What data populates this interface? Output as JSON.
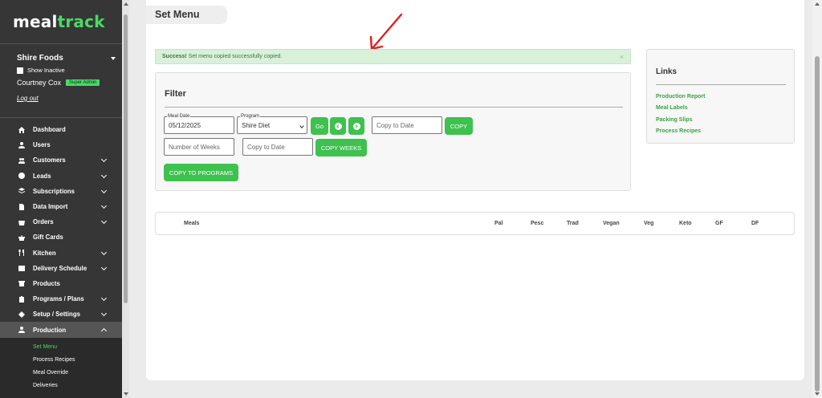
{
  "logo": {
    "part1": "meal",
    "part2": "track"
  },
  "account": {
    "name": "Shire Foods",
    "show_inactive": "Show Inactive",
    "user": "Courtney Cox",
    "role": "Super Admin",
    "logout": "Log out"
  },
  "nav": [
    {
      "label": "Dashboard",
      "icon": "home-icon",
      "has_sub": false
    },
    {
      "label": "Users",
      "icon": "user-icon",
      "has_sub": false
    },
    {
      "label": "Customers",
      "icon": "users-icon",
      "has_sub": true
    },
    {
      "label": "Leads",
      "icon": "bolt-icon",
      "has_sub": true
    },
    {
      "label": "Subscriptions",
      "icon": "layers-icon",
      "has_sub": true
    },
    {
      "label": "Data Import",
      "icon": "file-icon",
      "has_sub": true
    },
    {
      "label": "Orders",
      "icon": "basket-icon",
      "has_sub": true
    },
    {
      "label": "Gift Cards",
      "icon": "gift-icon",
      "has_sub": false
    },
    {
      "label": "Kitchen",
      "icon": "utensils-icon",
      "has_sub": true
    },
    {
      "label": "Delivery Schedule",
      "icon": "calendar-icon",
      "has_sub": true
    },
    {
      "label": "Products",
      "icon": "box-icon",
      "has_sub": false
    },
    {
      "label": "Programs / Plans",
      "icon": "clipboard-icon",
      "has_sub": true
    },
    {
      "label": "Setup / Settings",
      "icon": "gear-icon",
      "has_sub": true
    },
    {
      "label": "Production",
      "icon": "user-icon",
      "has_sub": true,
      "expanded": true
    }
  ],
  "subnav": [
    "Set Menu",
    "Process Recipes",
    "Meal Override",
    "Deliveries"
  ],
  "page": {
    "title": "Set Menu"
  },
  "alert": {
    "strong": "Success!",
    "message": " Set menu copied successfully copied.",
    "close": "×"
  },
  "filter": {
    "title": "Filter",
    "meal_date_label": "Meal Date",
    "meal_date_value": "05/12/2025",
    "program_label": "Program",
    "program_value": "Shire Diet",
    "go": "Go",
    "copy_to_date_placeholder": "Copy to Date",
    "copy": "COPY",
    "weeks_placeholder": "Number of Weeks",
    "copy_to_date2_placeholder": "Copy to Date",
    "copy_weeks": "COPY WEEKS",
    "copy_programs": "COPY TO PROGRAMS"
  },
  "links": {
    "title": "Links",
    "items": [
      "Production Report",
      "Meal Labels",
      "Packing Slips",
      "Process Recipes"
    ]
  },
  "table": {
    "headers": [
      "Meals",
      "Pal",
      "Pesc",
      "Trad",
      "Vegan",
      "Veg",
      "Keto",
      "GF",
      "DF"
    ]
  },
  "colors": {
    "sidebar": "#363636",
    "accent": "#3ec14f",
    "link": "#3ba244",
    "alert_bg": "#d9f0d9",
    "annotation_arrow": "#e02020"
  }
}
